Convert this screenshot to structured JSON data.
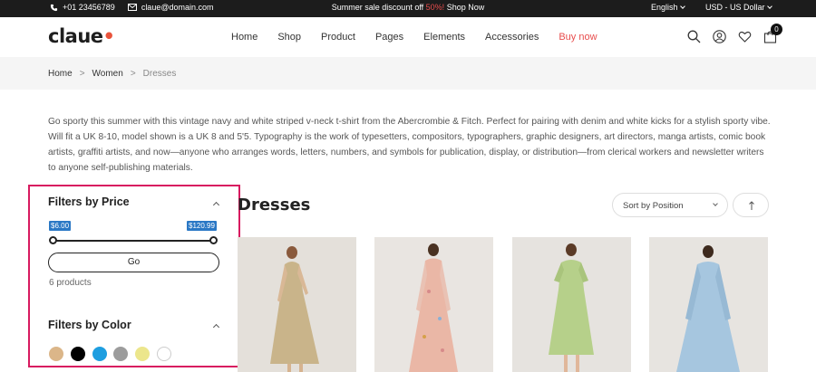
{
  "topbar": {
    "phone": "+01 23456789",
    "email": "claue@domain.com",
    "promo_text": "Summer sale discount off ",
    "promo_pct": "50%!",
    "promo_link": " Shop Now",
    "language": "English",
    "currency": "USD - US Dollar"
  },
  "header": {
    "logo_text": "claue",
    "nav": [
      "Home",
      "Shop",
      "Product",
      "Pages",
      "Elements",
      "Accessories",
      "Buy now"
    ],
    "cart_count": "0"
  },
  "breadcrumb": {
    "items": [
      "Home",
      "Women",
      "Dresses"
    ]
  },
  "description": "Go sporty this summer with this vintage navy and white striped v-neck t-shirt from the Abercrombie & Fitch. Perfect for pairing with denim and white kicks for a stylish sporty vibe. Will fit a UK 8-10, model shown is a UK 8 and 5'5. Typography is the work of typesetters, compositors, typographers, graphic designers, art directors, manga artists, comic book artists, graffiti artists, and now—anyone who arranges words, letters, numbers, and symbols for publication, display, or distribution—from clerical workers and newsletter writers to anyone self-publishing materials.",
  "filters": {
    "price_title": "Filters by Price",
    "min_price": "$6.00",
    "max_price": "$120.99",
    "go_label": "Go",
    "product_count": "6 products",
    "color_title": "Filters by Color",
    "colors": [
      "#dbb689",
      "#000000",
      "#1e9ee0",
      "#9c9c9c",
      "#ece68c",
      "#ffffff"
    ]
  },
  "listing": {
    "title": "Dresses",
    "sort_label": "Sort by Position",
    "products": [
      {
        "color": "#c9b48a"
      },
      {
        "color": "#eab7a6"
      },
      {
        "color": "#b6d08a"
      },
      {
        "color": "#a6c6df"
      }
    ]
  },
  "colors": {
    "accent": "#e84d4d",
    "highlight_border": "#d81b60",
    "price_tag": "#2a78c5"
  }
}
